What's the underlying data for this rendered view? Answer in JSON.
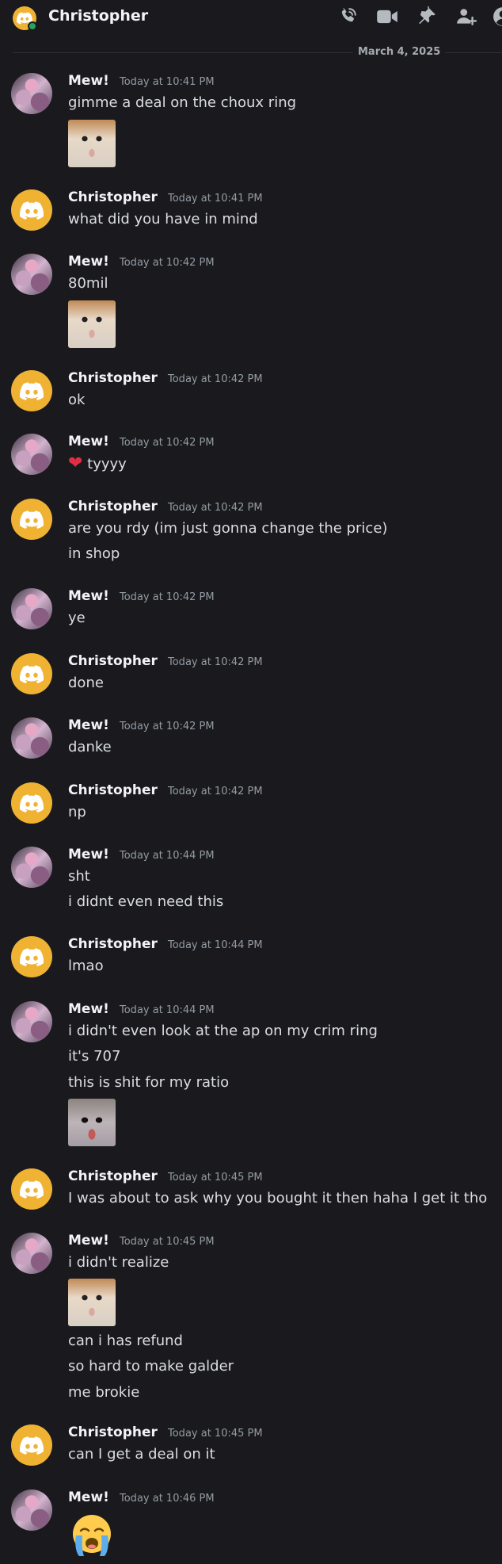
{
  "header": {
    "title": "Christopher",
    "icons": [
      "phone-call-icon",
      "video-camera-icon",
      "pin-icon",
      "add-friend-icon",
      "profile-icon"
    ]
  },
  "date_divider": "March 4, 2025",
  "colors": {
    "background": "#1a1a1e",
    "discord_avatar": "#f0b232",
    "online": "#23a55a"
  },
  "messages": [
    {
      "author": "Mew!",
      "time": "Today at 10:41 PM",
      "lines": [
        "gimme a deal on the choux ring"
      ],
      "images": [
        "cat-photo"
      ]
    },
    {
      "author": "Christopher",
      "time": "Today at 10:41 PM",
      "lines": [
        "what did you have in mind"
      ]
    },
    {
      "author": "Mew!",
      "time": "Today at 10:42 PM",
      "lines": [
        "80mil"
      ],
      "images": [
        "cat-photo"
      ]
    },
    {
      "author": "Christopher",
      "time": "Today at 10:42 PM",
      "lines": [
        "ok"
      ]
    },
    {
      "author": "Mew!",
      "time": "Today at 10:42 PM",
      "lines": [
        "tyyyy"
      ],
      "emoji": "red-heart"
    },
    {
      "author": "Christopher",
      "time": "Today at 10:42 PM",
      "lines": [
        "are you rdy (im just gonna change the price)",
        "in shop"
      ]
    },
    {
      "author": "Mew!",
      "time": "Today at 10:42 PM",
      "lines": [
        "ye"
      ]
    },
    {
      "author": "Christopher",
      "time": "Today at 10:42 PM",
      "lines": [
        "done"
      ]
    },
    {
      "author": "Mew!",
      "time": "Today at 10:42 PM",
      "lines": [
        "danke"
      ]
    },
    {
      "author": "Christopher",
      "time": "Today at 10:42 PM",
      "lines": [
        "np"
      ]
    },
    {
      "author": "Mew!",
      "time": "Today at 10:44 PM",
      "lines": [
        "sht",
        "i didnt even need this"
      ]
    },
    {
      "author": "Christopher",
      "time": "Today at 10:44 PM",
      "lines": [
        "lmao"
      ]
    },
    {
      "author": "Mew!",
      "time": "Today at 10:44 PM",
      "lines": [
        "i didn't even look at the ap on my crim ring",
        "it's 707",
        "this is shit for my ratio"
      ],
      "images": [
        "crying-cat-photo"
      ]
    },
    {
      "author": "Christopher",
      "time": "Today at 10:45 PM",
      "lines": [
        "I was about to ask why you bought it then haha I get it tho"
      ]
    },
    {
      "author": "Mew!",
      "time": "Today at 10:45 PM",
      "lines": [
        "i didn't realize",
        "can i has refund",
        "so hard to make galder",
        "me brokie"
      ],
      "images": [
        "cat-photo"
      ]
    },
    {
      "author": "Christopher",
      "time": "Today at 10:45 PM",
      "lines": [
        "can I get a deal on it"
      ]
    },
    {
      "author": "Mew!",
      "time": "Today at 10:46 PM",
      "lines": [],
      "emoji": "loudly-crying-face"
    }
  ]
}
